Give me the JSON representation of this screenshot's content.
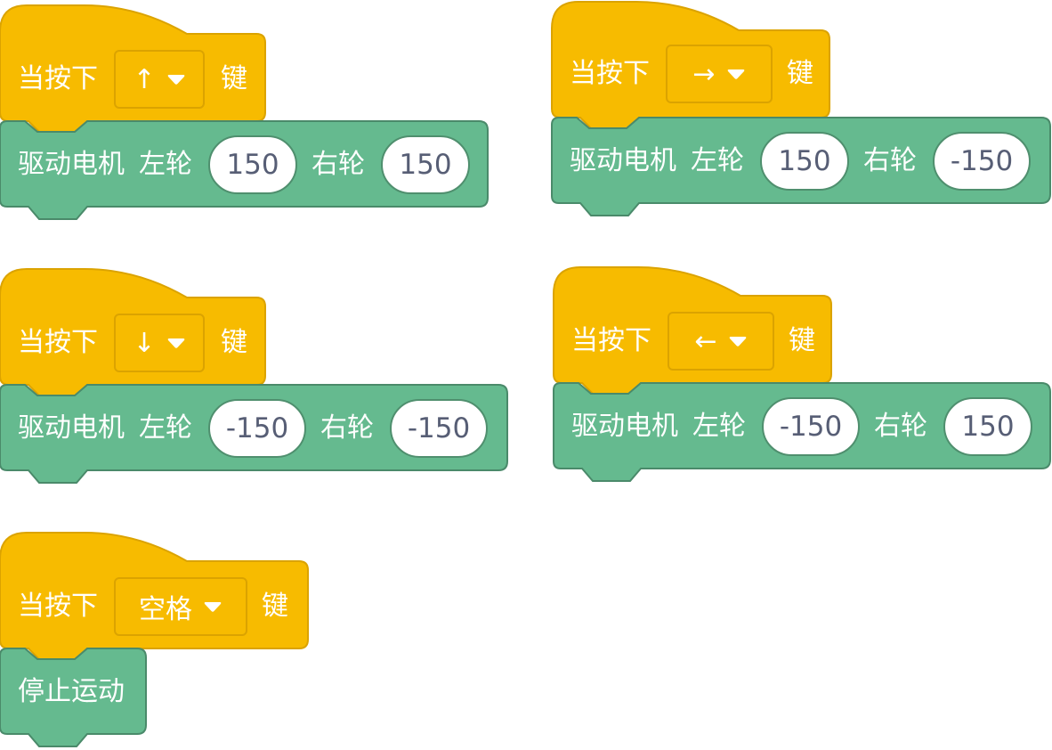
{
  "colors": {
    "hat_fill": "#F7BB00",
    "hat_stroke": "#DBA300",
    "command_fill": "#65BA8F",
    "command_stroke": "#4A8A6A",
    "input_text": "#575E75"
  },
  "scripts": [
    {
      "event": {
        "prefix": "当按下",
        "key": "↑",
        "suffix": "键",
        "caret": "caret-down-icon"
      },
      "command": {
        "label": "驱动电机",
        "left_label": "左轮",
        "left_value": "150",
        "right_label": "右轮",
        "right_value": "150"
      }
    },
    {
      "event": {
        "prefix": "当按下",
        "key": "→",
        "suffix": "键",
        "caret": "caret-down-icon"
      },
      "command": {
        "label": "驱动电机",
        "left_label": "左轮",
        "left_value": "150",
        "right_label": "右轮",
        "right_value": "-150"
      }
    },
    {
      "event": {
        "prefix": "当按下",
        "key": "↓",
        "suffix": "键",
        "caret": "caret-down-icon"
      },
      "command": {
        "label": "驱动电机",
        "left_label": "左轮",
        "left_value": "-150",
        "right_label": "右轮",
        "right_value": "-150"
      }
    },
    {
      "event": {
        "prefix": "当按下",
        "key": "←",
        "suffix": "键",
        "caret": "caret-down-icon"
      },
      "command": {
        "label": "驱动电机",
        "left_label": "左轮",
        "left_value": "-150",
        "right_label": "右轮",
        "right_value": "150"
      }
    },
    {
      "event": {
        "prefix": "当按下",
        "key": "空格",
        "suffix": "键",
        "caret": "caret-down-icon"
      },
      "command": {
        "label": "停止运动"
      }
    }
  ]
}
